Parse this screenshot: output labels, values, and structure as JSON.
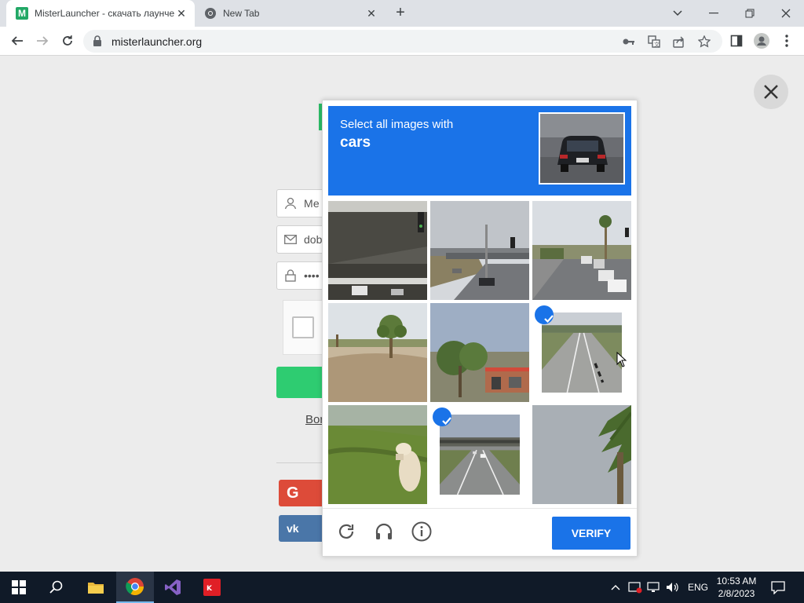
{
  "browser": {
    "tabs": [
      {
        "title": "MisterLauncher - скачать лаунче",
        "favicon": "M"
      },
      {
        "title": "New Tab"
      }
    ],
    "url": "misterlauncher.org"
  },
  "page": {
    "login_placeholder": "Ме",
    "email_value": "dob",
    "password_value": "••••",
    "link_text": "Bor",
    "social": {
      "google": "G",
      "vk": "vk"
    }
  },
  "captcha": {
    "prompt": "Select all images with",
    "target": "cars",
    "verify_label": "VERIFY",
    "tiles": [
      {
        "name": "overpass-underside",
        "selected": false
      },
      {
        "name": "highway-overpass",
        "selected": false
      },
      {
        "name": "street-with-cars",
        "selected": false
      },
      {
        "name": "palm-tree-dirt",
        "selected": false
      },
      {
        "name": "trees-shop",
        "selected": false
      },
      {
        "name": "empty-road",
        "selected": true
      },
      {
        "name": "grass-hydrant",
        "selected": false
      },
      {
        "name": "road-with-cars",
        "selected": true
      },
      {
        "name": "palm-sky",
        "selected": false
      }
    ],
    "accent_color": "#1a73e8"
  },
  "taskbar": {
    "language": "ENG",
    "time": "10:53 AM",
    "date": "2/8/2023"
  }
}
